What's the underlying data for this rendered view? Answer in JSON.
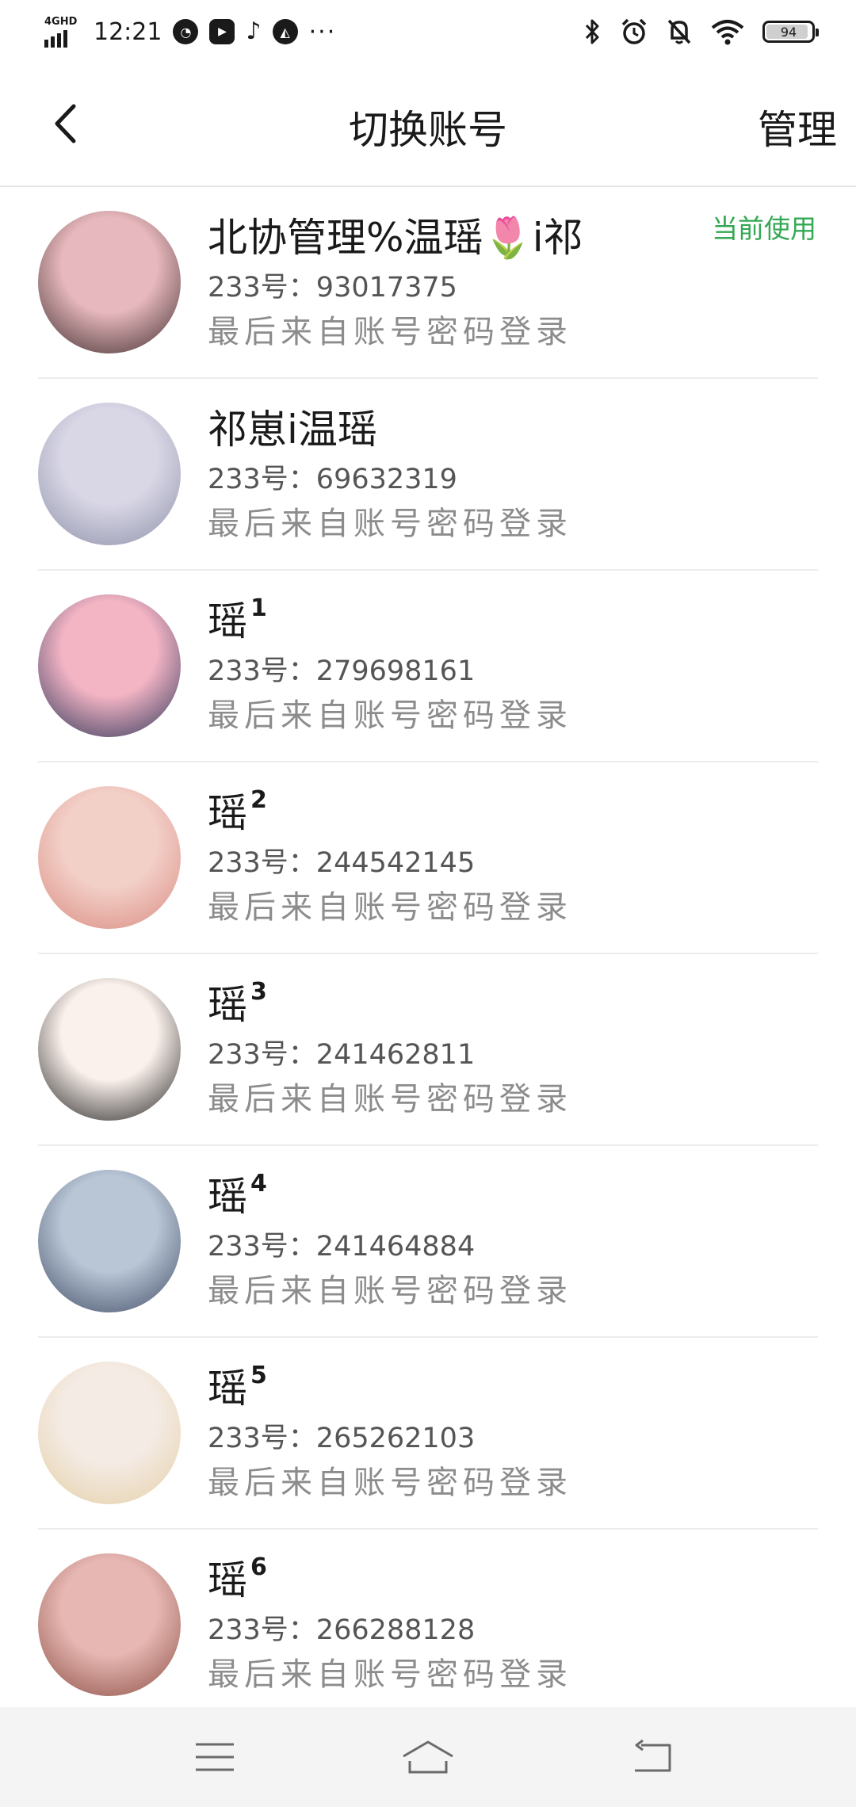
{
  "status_bar": {
    "network": "4GHD",
    "time": "12:21",
    "battery": "94",
    "battery_fraction": 0.94,
    "left_icons": [
      "speed-icon",
      "video-icon",
      "tiktok-icon",
      "app-icon",
      "more-dots-icon"
    ],
    "right_icons": [
      "bluetooth-icon",
      "alarm-icon",
      "mute-icon",
      "wifi-icon",
      "battery-icon"
    ]
  },
  "header": {
    "title": "切换账号",
    "manage_label": "管理"
  },
  "accounts": [
    {
      "name": "北协管理%温瑶🌷i祁",
      "sup": "",
      "id": "233号：93017375",
      "source": "最后来自账号密码登录",
      "current": "当前使用",
      "avatar_colors": [
        "#e7b8bd",
        "#3b2a2a"
      ]
    },
    {
      "name": "祁崽i温瑶",
      "sup": "",
      "id": "233号：69632319",
      "source": "最后来自账号密码登录",
      "current": "",
      "avatar_colors": [
        "#d9d7e6",
        "#8c8fa8"
      ]
    },
    {
      "name": "瑶",
      "sup": "1",
      "id": "233号：279698161",
      "source": "最后来自账号密码登录",
      "current": "",
      "avatar_colors": [
        "#f3b4c4",
        "#2b3457"
      ]
    },
    {
      "name": "瑶",
      "sup": "2",
      "id": "233号：244542145",
      "source": "最后来自账号密码登录",
      "current": "",
      "avatar_colors": [
        "#f2cfc7",
        "#d98a80"
      ]
    },
    {
      "name": "瑶",
      "sup": "3",
      "id": "233号：241462811",
      "source": "最后来自账号密码登录",
      "current": "",
      "avatar_colors": [
        "#fbf1ec",
        "#1e1e1e"
      ]
    },
    {
      "name": "瑶",
      "sup": "4",
      "id": "233号：241464884",
      "source": "最后来自账号密码登录",
      "current": "",
      "avatar_colors": [
        "#b9c6d6",
        "#3e4a63"
      ]
    },
    {
      "name": "瑶",
      "sup": "5",
      "id": "233号：265262103",
      "source": "最后来自账号密码登录",
      "current": "",
      "avatar_colors": [
        "#f4ebe4",
        "#e4cfa6"
      ]
    },
    {
      "name": "瑶",
      "sup": "6",
      "id": "233号：266288128",
      "source": "最后来自账号密码登录",
      "current": "",
      "avatar_colors": [
        "#e7b7b3",
        "#8a4e43"
      ]
    }
  ],
  "navigation": {
    "icons": [
      "menu-icon",
      "home-icon",
      "back-icon"
    ]
  }
}
